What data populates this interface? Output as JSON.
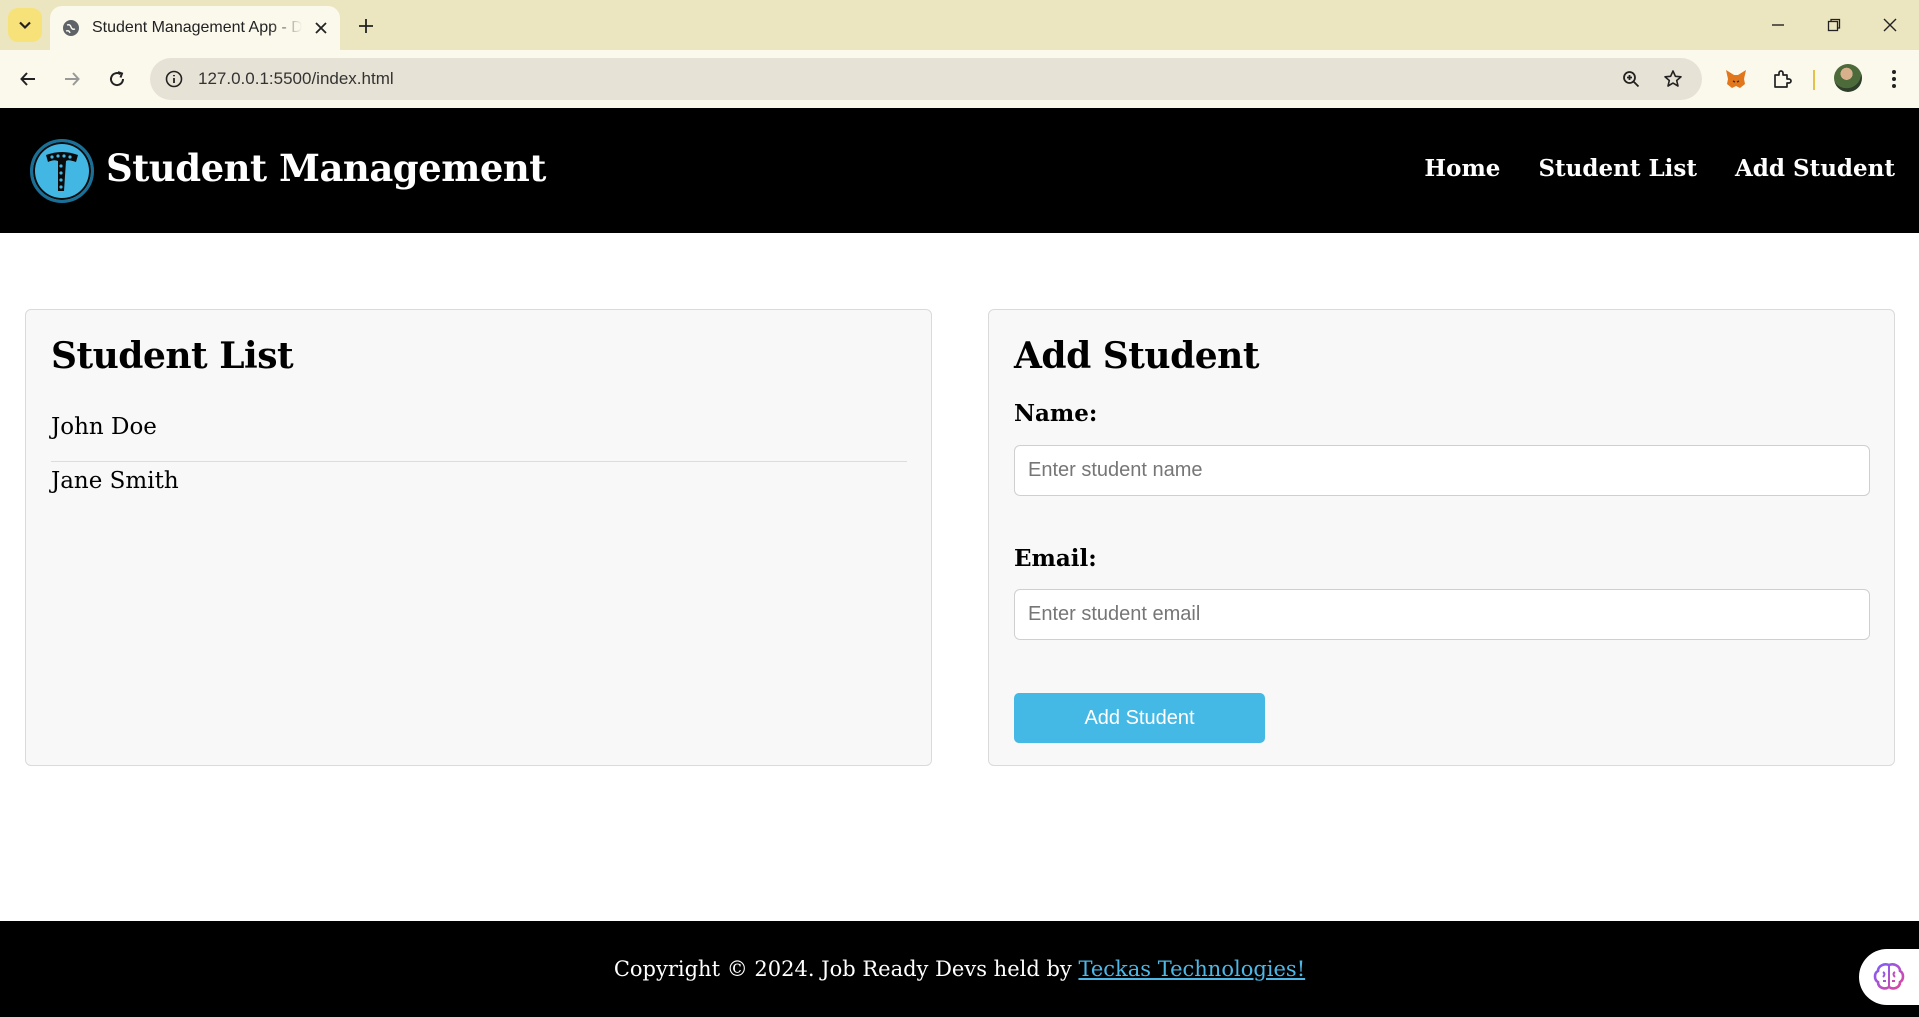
{
  "browser": {
    "tab_title": "Student Management App - Dashboard",
    "url": "127.0.0.1:5500/index.html"
  },
  "header": {
    "brand": "Student Management",
    "nav": [
      "Home",
      "Student List",
      "Add Student"
    ]
  },
  "student_list": {
    "title": "Student List",
    "students": [
      "John Doe",
      "Jane Smith"
    ]
  },
  "add_student": {
    "title": "Add Student",
    "name_label": "Name:",
    "name_placeholder": "Enter student name",
    "email_label": "Email:",
    "email_placeholder": "Enter student email",
    "submit_label": "Add Student"
  },
  "footer": {
    "text": "Copyright © 2024. Job Ready Devs held by ",
    "link_text": "Teckas Technologies!"
  },
  "colors": {
    "accent": "#45b9e6",
    "header_bg": "#000000",
    "tabstrip_bg": "#ebe5c0"
  }
}
